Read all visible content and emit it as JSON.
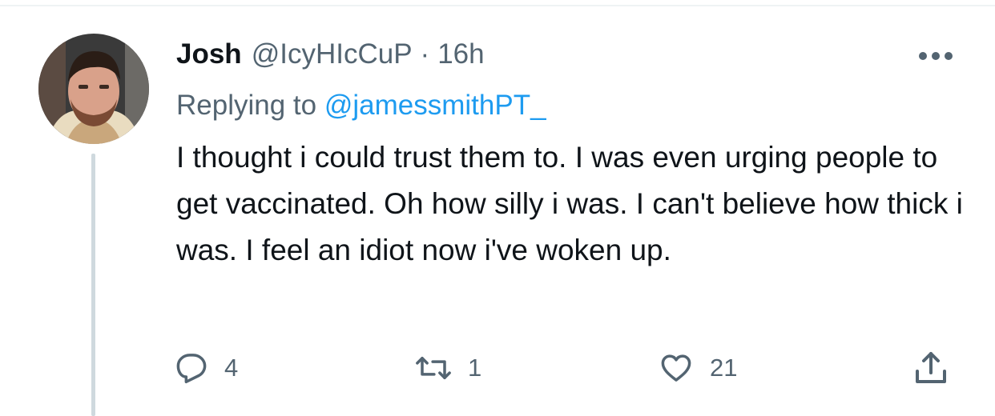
{
  "author": {
    "display_name": "Josh",
    "handle": "@IcyHIcCuP",
    "separator": "·",
    "time": "16h"
  },
  "reply_context": {
    "prefix": "Replying to",
    "handle": "@jamessmithPT_"
  },
  "tweet": {
    "text": "I thought i could trust them to. I was even urging people to get vaccinated. Oh how silly i was. I can't believe how thick i was. I feel an idiot now i've woken up."
  },
  "actions": {
    "reply_count": "4",
    "retweet_count": "1",
    "like_count": "21"
  },
  "icons": {
    "more": "more-horizontal-icon",
    "reply": "reply-icon",
    "retweet": "retweet-icon",
    "like": "heart-icon",
    "share": "share-icon"
  },
  "colors": {
    "text_primary": "#0f1419",
    "text_secondary": "#536471",
    "link": "#1d9bf0",
    "thread_line": "#cfd9de"
  }
}
